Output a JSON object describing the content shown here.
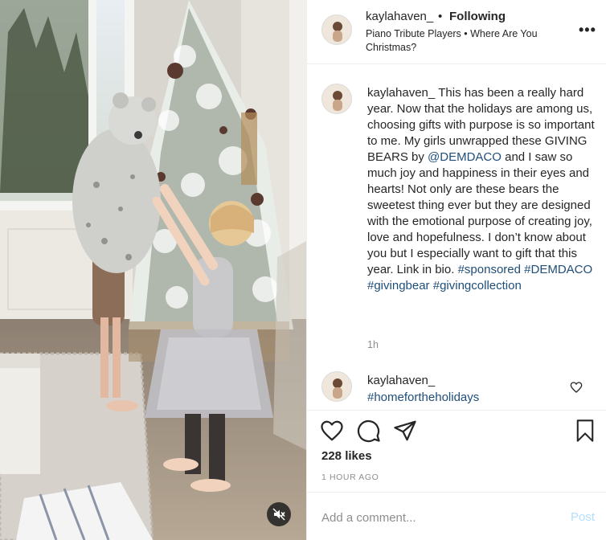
{
  "post": {
    "username": "kaylahaven_",
    "follow_label": "Following",
    "dot": "•",
    "audio": "Piano Tribute Players • Where Are You Christmas?",
    "more": "•••"
  },
  "caption": {
    "username": "kaylahaven_",
    "text_1": "This has been a really hard year. Now that the holidays are among us, choosing gifts with purpose is so important to me. My girls unwrapped these GIVING BEARS by ",
    "mention": "@DEMDACO",
    "text_2": " and I saw so much joy and happiness in their eyes and hearts! Not only are these bears the sweetest thing ever but they are designed with the emotional purpose of creating joy, love and hopefulness. I don’t know about you but I especially want to gift that this year. Link in bio. ",
    "hashtags": [
      "#sponsored",
      "#DEMDACO",
      "#givingbear",
      "#givingcollection"
    ],
    "time": "1h"
  },
  "comment": {
    "username": "kaylahaven_",
    "text": "#homefortheholidays"
  },
  "actions": {
    "likes": "228 likes",
    "time": "1 HOUR AGO"
  },
  "add_comment": {
    "placeholder": "Add a comment...",
    "post_label": "Post"
  },
  "icons": {
    "like": "heart-icon",
    "comment": "comment-icon",
    "share": "share-icon",
    "save": "bookmark-icon",
    "mute": "speaker-muted-icon",
    "comment_like": "small-heart-icon"
  },
  "colors": {
    "link": "#1f4e79",
    "post_button": "#b2dffc",
    "secondary_text": "#8e8e8e"
  }
}
